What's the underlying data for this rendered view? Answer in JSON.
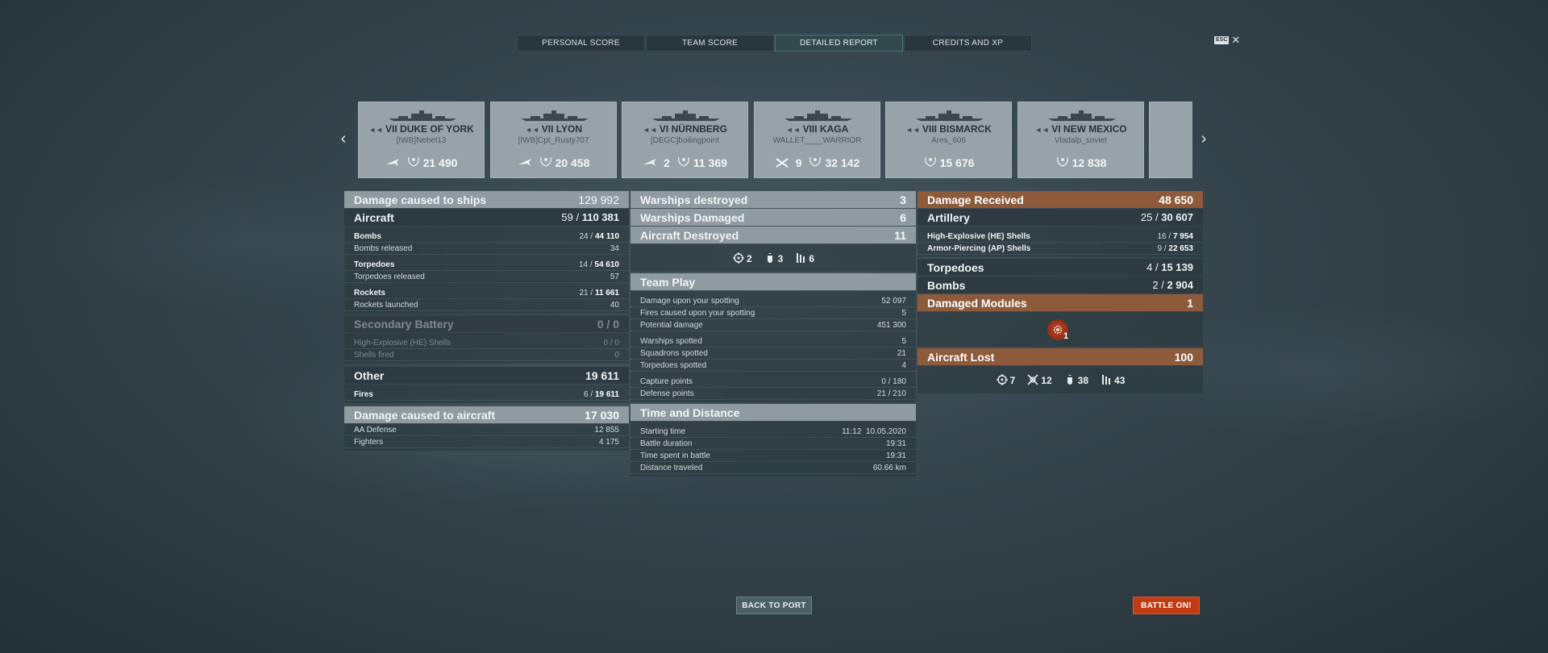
{
  "tabs": [
    {
      "label": "PERSONAL SCORE"
    },
    {
      "label": "TEAM SCORE"
    },
    {
      "label": "DETAILED REPORT",
      "active": true
    },
    {
      "label": "CREDITS AND XP"
    }
  ],
  "esc": {
    "key_label": "ESC",
    "close_glyph": "✕"
  },
  "carousel": {
    "prev_glyph": "‹",
    "next_glyph": "›",
    "ships": [
      {
        "tier_name": "VII DUKE OF YORK",
        "player": "[IWB]Nebel13",
        "kills": "",
        "score": "21 490",
        "icon": "plane-icon"
      },
      {
        "tier_name": "VII LYON",
        "player": "[IWB]Cpt_Rusty707",
        "kills": "",
        "score": "20 458",
        "icon": "plane-icon"
      },
      {
        "tier_name": "VI NÜRNBERG",
        "player": "[DEGC]boilingpoint",
        "kills": "2",
        "score": "11 369",
        "icon": "plane-icon"
      },
      {
        "tier_name": "VIII KAGA",
        "player": "WALLET____WARRIOR",
        "kills": "9",
        "score": "32 142",
        "icon": "crossed-planes-icon"
      },
      {
        "tier_name": "VIII BISMARCK",
        "player": "Ares_606",
        "kills": "",
        "score": "15 676",
        "icon": ""
      },
      {
        "tier_name": "VI NEW MEXICO",
        "player": "Vladalp_soviet",
        "kills": "",
        "score": "12 838",
        "icon": ""
      }
    ]
  },
  "left": {
    "damage_ships": {
      "label": "Damage caused to ships",
      "value": "129 992"
    },
    "aircraft": {
      "label": "Aircraft",
      "hits": "59",
      "dmg": "110 381"
    },
    "bombs": {
      "label": "Bombs",
      "hits": "24",
      "dmg": "44 110"
    },
    "bombs_released": {
      "label": "Bombs released",
      "value": "34"
    },
    "torpedoes": {
      "label": "Torpedoes",
      "hits": "14",
      "dmg": "54 610"
    },
    "torpedoes_released": {
      "label": "Torpedoes released",
      "value": "57"
    },
    "rockets": {
      "label": "Rockets",
      "hits": "21",
      "dmg": "11 661"
    },
    "rockets_launched": {
      "label": "Rockets launched",
      "value": "40"
    },
    "secondary": {
      "label": "Secondary Battery",
      "value": "0 / 0"
    },
    "he_shells": {
      "label": "High-Explosive (HE) Shells",
      "value": "0 / 0"
    },
    "shells_fired": {
      "label": "Shells fired",
      "value": "0"
    },
    "other": {
      "label": "Other",
      "value": "19 611"
    },
    "fires": {
      "label": "Fires",
      "hits": "6",
      "dmg": "19 611"
    },
    "damage_aircraft": {
      "label": "Damage caused to aircraft",
      "value": "17 030"
    },
    "aa_defense": {
      "label": "AA Defense",
      "value": "12 855"
    },
    "fighters": {
      "label": "Fighters",
      "value": "4 175"
    }
  },
  "middle": {
    "warships_destroyed": {
      "label": "Warships destroyed",
      "value": "3"
    },
    "warships_damaged": {
      "label": "Warships Damaged",
      "value": "6"
    },
    "aircraft_destroyed": {
      "label": "Aircraft Destroyed",
      "value": "11"
    },
    "aircraft_icons": [
      {
        "icon": "crosshair-icon",
        "value": "2"
      },
      {
        "icon": "bomb-icon",
        "value": "3"
      },
      {
        "icon": "torpedo-icon",
        "value": "6"
      }
    ],
    "team_play": {
      "title": "Team Play",
      "rows": [
        {
          "label": "Damage upon your spotting",
          "value": "52 097"
        },
        {
          "label": "Fires caused upon your spotting",
          "value": "5"
        },
        {
          "label": "Potential damage",
          "value": "451 300"
        }
      ],
      "rows2": [
        {
          "label": "Warships spotted",
          "value": "5"
        },
        {
          "label": "Squadrons spotted",
          "value": "21"
        },
        {
          "label": "Torpedoes spotted",
          "value": "4"
        }
      ],
      "rows3": [
        {
          "label": "Capture points",
          "value": "0 / 180"
        },
        {
          "label": "Defense points",
          "value": "21 / 210"
        }
      ]
    },
    "time_distance": {
      "title": "Time and Distance",
      "rows": [
        {
          "label": "Starting time",
          "value": "11:12  10.05.2020"
        },
        {
          "label": "Battle duration",
          "value": "19:31"
        },
        {
          "label": "Time spent in battle",
          "value": "19:31"
        },
        {
          "label": "Distance traveled",
          "value": "60.66 km"
        }
      ]
    }
  },
  "right": {
    "damage_received": {
      "label": "Damage Received",
      "value": "48 650"
    },
    "artillery": {
      "label": "Artillery",
      "hits": "25",
      "dmg": "30 607"
    },
    "he_shells": {
      "label": "High-Explosive (HE) Shells",
      "hits": "16",
      "dmg": "7 954"
    },
    "ap_shells": {
      "label": "Armor-Piercing (AP) Shells",
      "hits": "9",
      "dmg": "22 653"
    },
    "torpedoes": {
      "label": "Torpedoes",
      "hits": "4",
      "dmg": "15 139"
    },
    "bombs": {
      "label": "Bombs",
      "hits": "2",
      "dmg": "2 904"
    },
    "damaged_modules": {
      "label": "Damaged Modules",
      "value": "1"
    },
    "module_count": "1",
    "aircraft_lost": {
      "label": "Aircraft Lost",
      "value": "100"
    },
    "lost_icons": [
      {
        "icon": "crosshair-icon",
        "value": "7"
      },
      {
        "icon": "shot-down-icon",
        "value": "12"
      },
      {
        "icon": "bomb-icon",
        "value": "38"
      },
      {
        "icon": "torpedo-icon",
        "value": "43"
      }
    ]
  },
  "buttons": {
    "back": "BACK TO PORT",
    "battle": "BATTLE ON!"
  },
  "colors": {
    "accent_orange": "#8d5a3b",
    "battle_red": "#c23a12",
    "tab_active": "#3f7a78"
  }
}
